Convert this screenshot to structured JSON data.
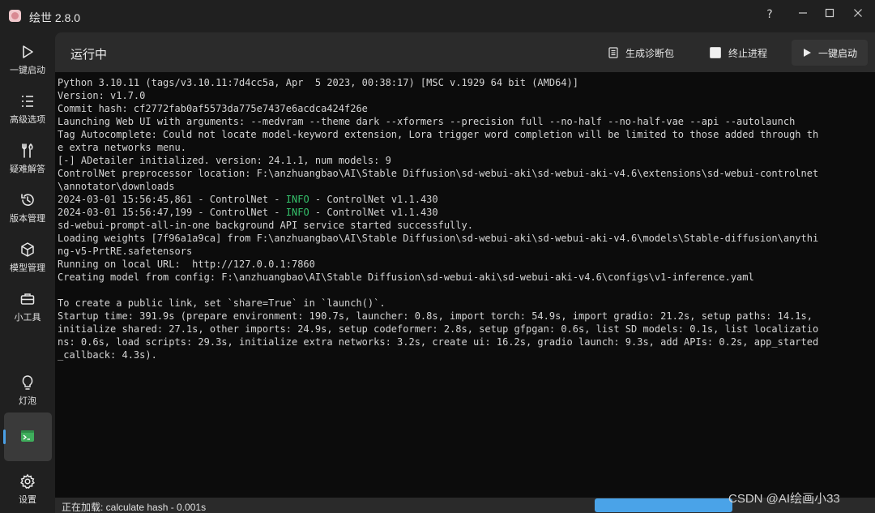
{
  "window": {
    "title": "绘世 2.8.0",
    "help_glyph": "?",
    "min_glyph": "—",
    "max_glyph": "☐",
    "close_glyph": "✕"
  },
  "sidebar": {
    "items": [
      {
        "label": "一键启动",
        "icon": "play-icon"
      },
      {
        "label": "高级选项",
        "icon": "list-icon"
      },
      {
        "label": "疑难解答",
        "icon": "tools-icon"
      },
      {
        "label": "版本管理",
        "icon": "history-icon"
      },
      {
        "label": "模型管理",
        "icon": "cube-icon"
      },
      {
        "label": "小工具",
        "icon": "toolbox-icon"
      },
      {
        "label": "灯泡",
        "icon": "bulb-icon"
      },
      {
        "label": "",
        "icon": "terminal-icon"
      },
      {
        "label": "设置",
        "icon": "gear-icon"
      }
    ]
  },
  "header": {
    "title": "运行中",
    "diagnostic_label": "生成诊断包",
    "terminate_label": "终止进程",
    "launch_label": "一键启动"
  },
  "console": {
    "lines": [
      "Python 3.10.11 (tags/v3.10.11:7d4cc5a, Apr  5 2023, 00:38:17) [MSC v.1929 64 bit (AMD64)]",
      "Version: v1.7.0",
      "Commit hash: cf2772fab0af5573da775e7437e6acdca424f26e",
      "Launching Web UI with arguments: --medvram --theme dark --xformers --precision full --no-half --no-half-vae --api --autolaunch",
      "Tag Autocomplete: Could not locate model-keyword extension, Lora trigger word completion will be limited to those added through th",
      "e extra networks menu.",
      "[-] ADetailer initialized. version: 24.1.1, num models: 9",
      "ControlNet preprocessor location: F:\\anzhuangbao\\AI\\Stable Diffusion\\sd-webui-aki\\sd-webui-aki-v4.6\\extensions\\sd-webui-controlnet",
      "\\annotator\\downloads",
      "2024-03-01 15:56:45,861 - ControlNet - ",
      "2024-03-01 15:56:47,199 - ControlNet - ",
      "sd-webui-prompt-all-in-one background API service started successfully.",
      "Loading weights [7f96a1a9ca] from F:\\anzhuangbao\\AI\\Stable Diffusion\\sd-webui-aki\\sd-webui-aki-v4.6\\models\\Stable-diffusion\\anythi",
      "ng-v5-PrtRE.safetensors",
      "Running on local URL:  http://127.0.0.1:7860",
      "Creating model from config: F:\\anzhuangbao\\AI\\Stable Diffusion\\sd-webui-aki\\sd-webui-aki-v4.6\\configs\\v1-inference.yaml",
      "",
      "To create a public link, set `share=True` in `launch()`.",
      "Startup time: 391.9s (prepare environment: 190.7s, launcher: 0.8s, import torch: 54.9s, import gradio: 21.2s, setup paths: 14.1s,",
      "initialize shared: 27.1s, other imports: 24.9s, setup codeformer: 2.8s, setup gfpgan: 0.6s, list SD models: 0.1s, list localizatio",
      "ns: 0.6s, load scripts: 29.3s, initialize extra networks: 3.2s, create ui: 16.2s, gradio launch: 9.3s, add APIs: 0.2s, app_started",
      "_callback: 4.3s)."
    ],
    "info_tag": "INFO",
    "info_suffix": " - ControlNet v1.1.430"
  },
  "status": {
    "text": "正在加载: calculate hash - 0.001s",
    "progress": 0.55
  },
  "watermark": "CSDN @AI绘画小33",
  "colors": {
    "accent": "#4aa3e8",
    "info": "#35c26b",
    "console_bg": "#0c0c0c"
  }
}
